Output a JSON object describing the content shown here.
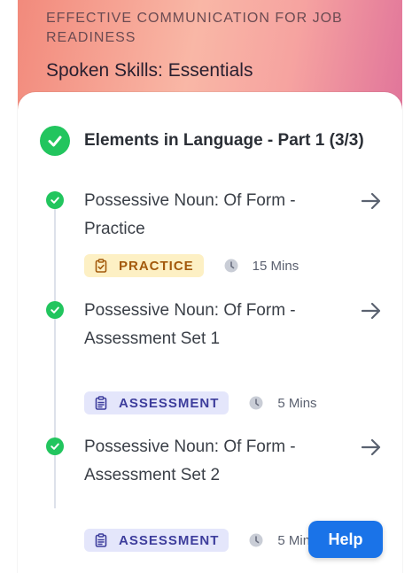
{
  "header": {
    "course_title": "EFFECTIVE COMMUNICATION FOR JOB READINESS",
    "module_title": "Spoken Skills: Essentials"
  },
  "section": {
    "title": "Elements in Language - Part 1 (3/3)"
  },
  "lessons": [
    {
      "title": "Possessive Noun: Of Form - Practice",
      "type": "PRACTICE",
      "duration": "15 Mins",
      "completed": true
    },
    {
      "title": "Possessive Noun: Of Form - Assessment Set 1",
      "type": "ASSESSMENT",
      "duration": "5 Mins",
      "completed": true
    },
    {
      "title": "Possessive Noun: Of Form - Assessment Set 2",
      "type": "ASSESSMENT",
      "duration": "5 Mins",
      "completed": true
    }
  ],
  "help_button": {
    "label": "Help"
  },
  "colors": {
    "success": "#22c55e",
    "practice_bg": "#fdf0c4",
    "practice_text": "#a35a0c",
    "assessment_bg": "#e4e6fb",
    "assessment_text": "#3d3d9c",
    "help_bg": "#1a73e8"
  },
  "icons": {
    "check": "check-icon",
    "arrow": "arrow-right-icon",
    "practice": "clipboard-check-icon",
    "assessment": "clipboard-list-icon",
    "clock": "clock-icon"
  }
}
